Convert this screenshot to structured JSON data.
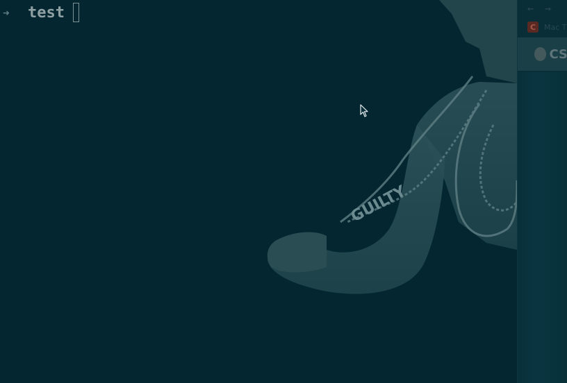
{
  "terminal": {
    "prompt_symbol": "➜",
    "command_text": "test"
  },
  "background_window": {
    "nav_back": "←",
    "nav_forward": "→",
    "tab_icon_letter": "C",
    "tab_label": "Mac T",
    "header_label": "CS"
  },
  "wallpaper": {
    "text": "GUILTY"
  },
  "colors": {
    "terminal_bg": "#032630",
    "prompt_text": "#8fa1a3",
    "arrow": "#5f7d83"
  },
  "icons": {
    "prompt": "right-arrow-icon",
    "cursor": "mouse-pointer-icon"
  }
}
